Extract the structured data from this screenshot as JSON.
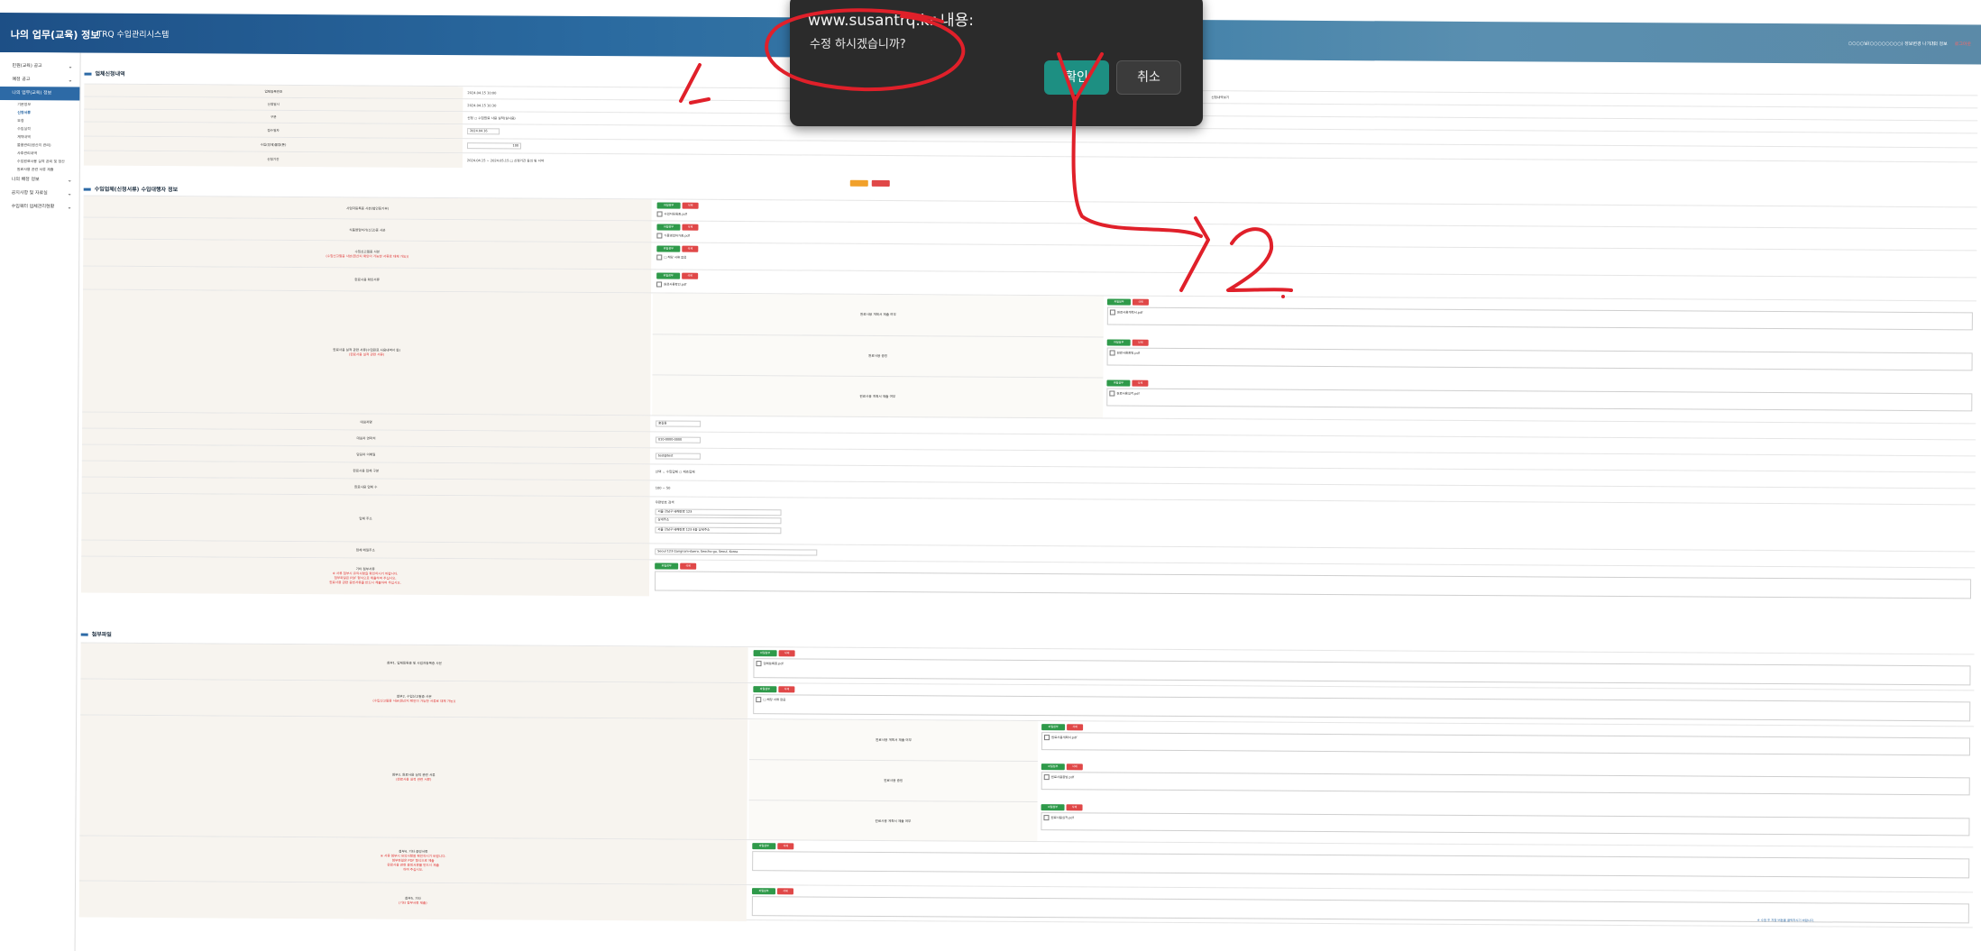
{
  "header": {
    "brand": "나의 업무(교육) 정보",
    "system": "TRQ 수입관리시스템",
    "user": "○○○○님(○○○○○○○○) 정보변경 나가기",
    "logout": "나의 정보",
    "logout_btn": "로그아웃"
  },
  "sidebar": {
    "items": [
      {
        "label": "민원(교육) 공고",
        "chev": "⌄"
      },
      {
        "label": "예정 공고",
        "chev": "⌄"
      },
      {
        "label": "나의 업무(교육) 정보",
        "chev": ""
      }
    ],
    "subs": [
      "기본정보",
      "신청서류",
      "요청",
      "수입실적",
      "계약내역",
      "물품관리(원산지 관리)",
      "사후관리내역",
      "수입원료사용 실적 관리 및 정산",
      "원료사용 관련 서류 제출"
    ],
    "items2": [
      {
        "label": "나의 배정 정보",
        "chev": "⌄"
      },
      {
        "label": "공지사항 및 자료실",
        "chev": "⌄"
      },
      {
        "label": "수입쿼터 업체관리현황",
        "chev": "⌄"
      }
    ]
  },
  "sections": {
    "s1": "업체신청내역",
    "s2": "수입업체(신청서류) 수입대행자 정보",
    "s3": "첨부파일"
  },
  "form1": {
    "rows": [
      {
        "label": "업체등록번호",
        "value": "2024.04.15 10:00"
      },
      {
        "label": "신청일시",
        "value": "2024.04.15 10:30"
      },
      {
        "label": "구분",
        "value": "신청  ○ 수입원료 사용 실적(실사용)"
      },
      {
        "label": "접수일자",
        "value": "2024.04.16"
      },
      {
        "label": "수입(정제)물량(톤)",
        "value": "100"
      },
      {
        "label": "신청기간",
        "value": "2024.04.15  ~  2024.05.15  □ 신청기간 동의 및 서약"
      }
    ],
    "right_label": "신청내역보기"
  },
  "upload_btn": "파일첨부",
  "delete_btn": "삭제",
  "form2": {
    "rows": [
      {
        "label": "사업자등록증 사본(법인등기부)",
        "check": "사업자등록증.pdf"
      },
      {
        "label": "식품영업허가(신고)증 사본",
        "check": "식품영업허가증.pdf"
      },
      {
        "label": "수입신고필증 사본",
        "red": "(수입신고필증 사본(원산지 확인이 가능한 서류로 대체 가능))",
        "check": "□ 해당 서류 없음"
      },
      {
        "label": "원료사용 확인서류",
        "check": "원료사용확인.pdf"
      }
    ],
    "group_label": "원료사용 실적 관련 서류(수입원료 사용내역서 등)",
    "group_red": "(원료사용 실적 관련 서류)",
    "sub_rows": [
      {
        "label": "원료사용 계획서 제출 여부",
        "check": "원료사용계획서.pdf"
      },
      {
        "label": "원료사용 증빙",
        "check": "원료사용증빙.pdf"
      },
      {
        "label": "원료사용 계획서 제출 여부",
        "check": "원료사용실적.pdf"
      }
    ],
    "field_rows": [
      {
        "label": "대표자명",
        "value": "홍길동"
      },
      {
        "label": "대표자 연락처",
        "value": "010-0000-0000"
      },
      {
        "label": "담당자 이메일",
        "value": "test@test"
      },
      {
        "label": "원료사용 업체 구분",
        "value": "선택  ⌄  수입업체  ○ 제조업체"
      },
      {
        "label": "원료사용 업체 수",
        "value": "100     ~     50"
      }
    ],
    "address_label": "업체 주소",
    "address_lines": [
      "우편번호  검색",
      "서울 강남구 테헤란로 123",
      "상세주소",
      "서울 강남구 테헤란로 123 4층 상세주소"
    ],
    "email_label": "업체 메일주소",
    "email_value": "Seoul 123 Gangnam-daero, Seocho-gu, Seoul, Korea",
    "note_label": "기타 첨부서류",
    "note_red": [
      "※ 서류 첨부시 유의사항을 확인하시기 바랍니다.",
      "첨부파일은 PDF 형식으로 제출하여 주십시오.",
      "원료사용 관련 증빙서류를 반드시 제출하여 주십시오."
    ]
  },
  "form3": {
    "rows": [
      {
        "label": "첨부1. 업체등록증 및 사업자등록증 사본",
        "check": "업체등록증.pdf"
      },
      {
        "label": "첨부2. 수입신고필증 사본",
        "red": "(수입신고필증 사본(원산지 확인이 가능한 서류로 대체 가능))",
        "check": "□ 해당 서류 없음"
      }
    ],
    "group_label": "첨부3. 원료사용 실적 관련 서류",
    "group_red": "(원료사용 실적 관련 서류)",
    "sub_rows": [
      {
        "label": "원료사용 계획서 제출 여부",
        "check": "원료사용계획서.pdf"
      },
      {
        "label": "원료사용 증빙",
        "check": "원료사용증빙.pdf"
      },
      {
        "label": "원료사용 계획서 제출 여부",
        "check": "원료사용실적.pdf"
      }
    ],
    "row4_label": "첨부4. 기타 증빙서류",
    "row4_red": [
      "※ 서류 첨부시 유의사항을 확인하시기 바랍니다.",
      "첨부파일은 PDF 형식으로 제출",
      "원료사용 관련 증빙서류를 반드시 제출",
      "하여 주십시오."
    ],
    "row5_label": "첨부5. 기타",
    "row5_red": "(기타 첨부서류 제출)"
  },
  "notice": "※ 수정 후 저장 버튼을 클릭하시기 바랍니다.",
  "dialog": {
    "title": "www.susantrq.kr 내용:",
    "message": "수정 하시겠습니까?",
    "ok": "확인",
    "cancel": "취소"
  },
  "annotation": {
    "label_1": "1.",
    "label_2": "2.",
    "color": "#e0202a"
  }
}
